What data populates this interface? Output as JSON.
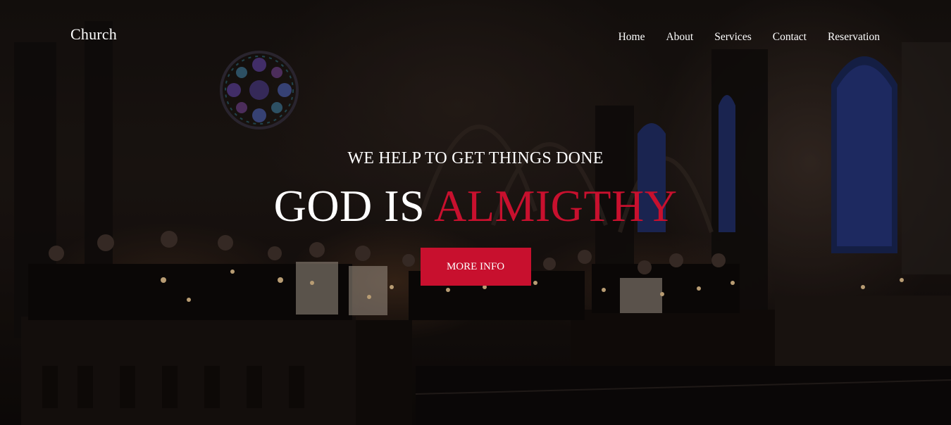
{
  "brand": {
    "name": "Church"
  },
  "nav": {
    "items": [
      {
        "label": "Home"
      },
      {
        "label": "About"
      },
      {
        "label": "Services"
      },
      {
        "label": "Contact"
      },
      {
        "label": "Reservation"
      }
    ]
  },
  "hero": {
    "tagline": "WE HELP TO GET THINGS DONE",
    "headline_main": "GOD IS",
    "headline_accent": "ALMIGTHY",
    "cta_label": "MORE INFO",
    "background_image": "candlelit cathedral interior"
  },
  "colors": {
    "accent": "#c8102e",
    "text": "#ffffff"
  }
}
